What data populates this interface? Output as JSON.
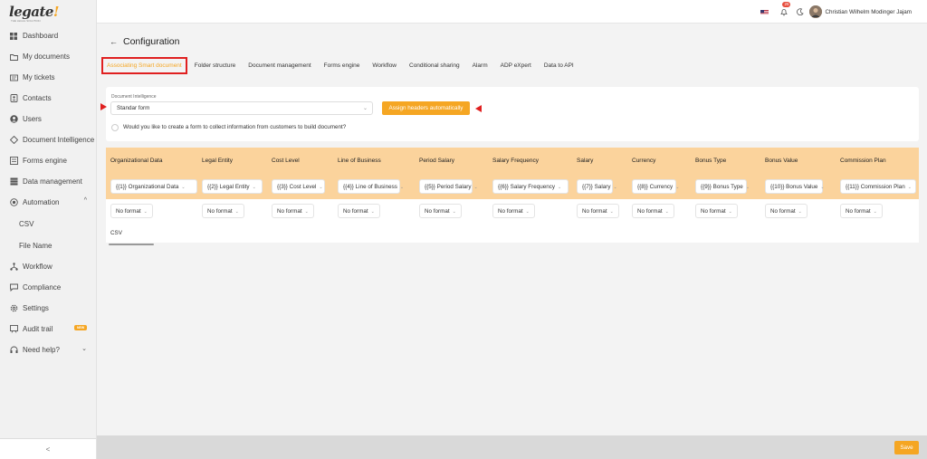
{
  "app": {
    "logo_text": "legate",
    "logo_accent": "!",
    "logo_sub": "THE LEGAL SOLUTION",
    "brand_color": "#f5a623"
  },
  "sidebar": {
    "items": [
      {
        "label": "Dashboard",
        "icon": "dashboard-icon"
      },
      {
        "label": "My documents",
        "icon": "folder-icon"
      },
      {
        "label": "My tickets",
        "icon": "ticket-icon"
      },
      {
        "label": "Contacts",
        "icon": "contacts-icon"
      },
      {
        "label": "Users",
        "icon": "user-icon"
      },
      {
        "label": "Document Intelligence",
        "icon": "diamond-icon"
      },
      {
        "label": "Forms engine",
        "icon": "form-icon"
      },
      {
        "label": "Data management",
        "icon": "database-icon"
      },
      {
        "label": "Automation",
        "icon": "automation-icon"
      },
      {
        "label": "CSV",
        "icon": ""
      },
      {
        "label": "File Name",
        "icon": ""
      },
      {
        "label": "Workflow",
        "icon": "workflow-icon"
      },
      {
        "label": "Compliance",
        "icon": "compliance-icon"
      },
      {
        "label": "Settings",
        "icon": "gear-icon"
      },
      {
        "label": "Audit trail",
        "icon": "audit-icon"
      },
      {
        "label": "Need help?",
        "icon": "headset-icon"
      }
    ],
    "audit_badge": "NEW",
    "collapse_icon": "<"
  },
  "topbar": {
    "notification_count": "25",
    "user_name": "Christian Wilhelm Modinger Jajam"
  },
  "page": {
    "back": "←",
    "title": "Configuration",
    "tabs": [
      "Associating Smart document",
      "Folder structure",
      "Document management",
      "Forms engine",
      "Workflow",
      "Conditional sharing",
      "Alarm",
      "ADP eXpert",
      "Data to API"
    ]
  },
  "config": {
    "di_label": "Document Intelligence",
    "di_value": "Standar form",
    "assign_button": "Assign headers automatically",
    "checkbox_label": "Would you like to create a form to collect information from customers to build document?"
  },
  "table": {
    "columns": [
      {
        "header": "Organizational Data",
        "mapping": "{{1}} Organizational Data",
        "format": "No format"
      },
      {
        "header": "Legal Entity",
        "mapping": "{{2}} Legal Entity",
        "format": "No format"
      },
      {
        "header": "Cost Level",
        "mapping": "{{3}} Cost Level",
        "format": "No format"
      },
      {
        "header": "Line of Business",
        "mapping": "{{4}} Line of Business",
        "format": "No format"
      },
      {
        "header": "Period Salary",
        "mapping": "{{5}} Period Salary",
        "format": "No format"
      },
      {
        "header": "Salary Frequency",
        "mapping": "{{6}} Salary Frequency",
        "format": "No format"
      },
      {
        "header": "Salary",
        "mapping": "{{7}} Salary",
        "format": "No format"
      },
      {
        "header": "Currency",
        "mapping": "{{8}} Currency",
        "format": "No format"
      },
      {
        "header": "Bonus Type",
        "mapping": "{{9}} Bonus Type",
        "format": "No format"
      },
      {
        "header": "Bonus Value",
        "mapping": "{{10}} Bonus Value",
        "format": "No format"
      },
      {
        "header": "Commission Plan",
        "mapping": "{{11}} Commission Plan",
        "format": "No format"
      }
    ],
    "footer_label": "CSV"
  },
  "footer": {
    "save": "Save"
  }
}
